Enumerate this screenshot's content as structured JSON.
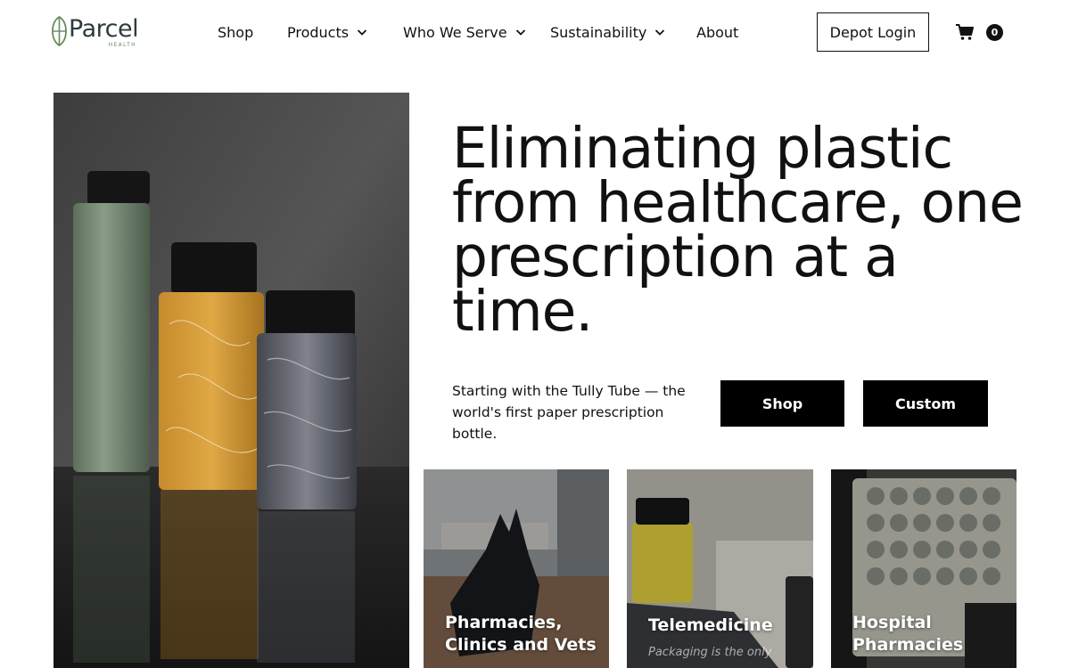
{
  "brand": {
    "name": "Parcel",
    "sub": "HEALTH",
    "mark_color": "#6a8a5e",
    "text_color": "#2f3a3c"
  },
  "nav": {
    "items": [
      {
        "label": "Shop",
        "dropdown": false
      },
      {
        "label": "Products",
        "dropdown": true
      },
      {
        "label": "Who We Serve",
        "dropdown": true
      },
      {
        "label": "Sustainability",
        "dropdown": true
      },
      {
        "label": "About",
        "dropdown": false
      }
    ],
    "depot_login": "Depot Login",
    "cart_icon": "shopping-cart-icon",
    "cart_count": "0"
  },
  "hero": {
    "headline": "Eliminating plastic from healthcare, one prescription at a time.",
    "subtext": "Starting with the Tully Tube — the world's first paper prescription bottle.",
    "shop_button": "Shop",
    "custom_button": "Custom"
  },
  "cards": [
    {
      "label": "Pharmacies, Clinics and Vets"
    },
    {
      "label": "Telemedicine",
      "caption": "Packaging is the only"
    },
    {
      "label": "Hospital Pharmacies"
    }
  ],
  "colors": {
    "accent": "#000000",
    "background": "#ffffff",
    "text": "#111111"
  }
}
